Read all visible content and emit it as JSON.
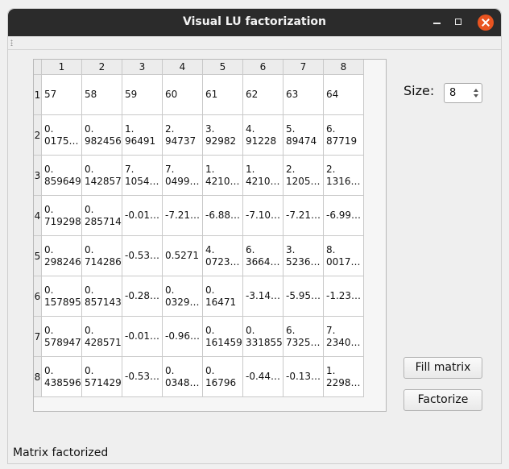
{
  "window": {
    "title": "Visual LU factorization"
  },
  "table": {
    "column_headers": [
      "1",
      "2",
      "3",
      "4",
      "5",
      "6",
      "7",
      "8"
    ],
    "row_headers": [
      "1",
      "2",
      "3",
      "4",
      "5",
      "6",
      "7",
      "8"
    ],
    "rows": [
      [
        "57",
        "58",
        "59",
        "60",
        "61",
        "62",
        "63",
        "64"
      ],
      [
        "0.\n0175…",
        "0.\n982456",
        "1.\n96491",
        "2.\n94737",
        "3.\n92982",
        "4.\n91228",
        "5.\n89474",
        "6.\n87719"
      ],
      [
        "0.\n859649",
        "0.\n142857",
        "7.\n1054…",
        "7.\n0499…",
        "1.\n4210…",
        "1.\n4210…",
        "2.\n1205…",
        "2.\n1316…"
      ],
      [
        "0.\n719298",
        "0.\n285714",
        "-0.01…",
        "-7.21…",
        "-6.88…",
        "-7.10…",
        "-7.21…",
        "-6.99…"
      ],
      [
        "0.\n298246",
        "0.\n714286",
        "-0.53…",
        "0.5271",
        "4.\n0723…",
        "6.\n3664…",
        "3.\n5236…",
        "8.\n0017…"
      ],
      [
        "0.\n157895",
        "0.\n857143",
        "-0.28…",
        "0.\n0329…",
        "0.\n16471",
        "-3.14…",
        "-5.95…",
        "-1.23…"
      ],
      [
        "0.\n578947",
        "0.\n428571",
        "-0.01…",
        "-0.96…",
        "0.\n161459",
        "0.\n331855",
        "6.\n7325…",
        "7.\n2340…"
      ],
      [
        "0.\n438596",
        "0.\n571429",
        "-0.53…",
        "0.\n0348…",
        "0.\n16796",
        "-0.44…",
        "-0.13…",
        "1.\n2298…"
      ]
    ]
  },
  "size_control": {
    "label": "Size:",
    "value": "8"
  },
  "buttons": {
    "fill_label": "Fill matrix",
    "factorize_label": "Factorize"
  },
  "status_bar": {
    "text": "Matrix factorized"
  },
  "colors": {
    "titlebar": "#2b2b2b",
    "close_button": "#e95420",
    "window_bg": "#efefef"
  }
}
